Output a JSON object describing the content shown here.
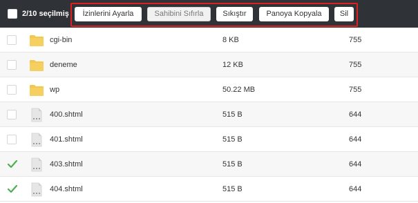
{
  "toolbar": {
    "selection_count": "2/10 seçilmiş",
    "buttons": {
      "permissions": "İzinlerini Ayarla",
      "reset_owner": "Sahibini Sıfırla",
      "compress": "Sıkıştır",
      "copy_clipboard": "Panoya Kopyala",
      "delete": "Sil"
    },
    "highlight_color": "#e02020"
  },
  "files": [
    {
      "name": "cgi-bin",
      "size": "8 KB",
      "perm": "755",
      "type": "folder-icon",
      "checked": false
    },
    {
      "name": "deneme",
      "size": "12 KB",
      "perm": "755",
      "type": "folder-icon",
      "checked": false
    },
    {
      "name": "wp",
      "size": "50.22 MB",
      "perm": "755",
      "type": "folder-icon",
      "checked": false
    },
    {
      "name": "400.shtml",
      "size": "515 B",
      "perm": "644",
      "type": "file-icon",
      "checked": false
    },
    {
      "name": "401.shtml",
      "size": "515 B",
      "perm": "644",
      "type": "file-icon",
      "checked": false
    },
    {
      "name": "403.shtml",
      "size": "515 B",
      "perm": "644",
      "type": "file-icon",
      "checked": true
    },
    {
      "name": "404.shtml",
      "size": "515 B",
      "perm": "644",
      "type": "file-icon",
      "checked": true
    }
  ],
  "colors": {
    "toolbar_bg": "#2f3338",
    "folder": "#f2c94c",
    "check": "#4caf50"
  }
}
